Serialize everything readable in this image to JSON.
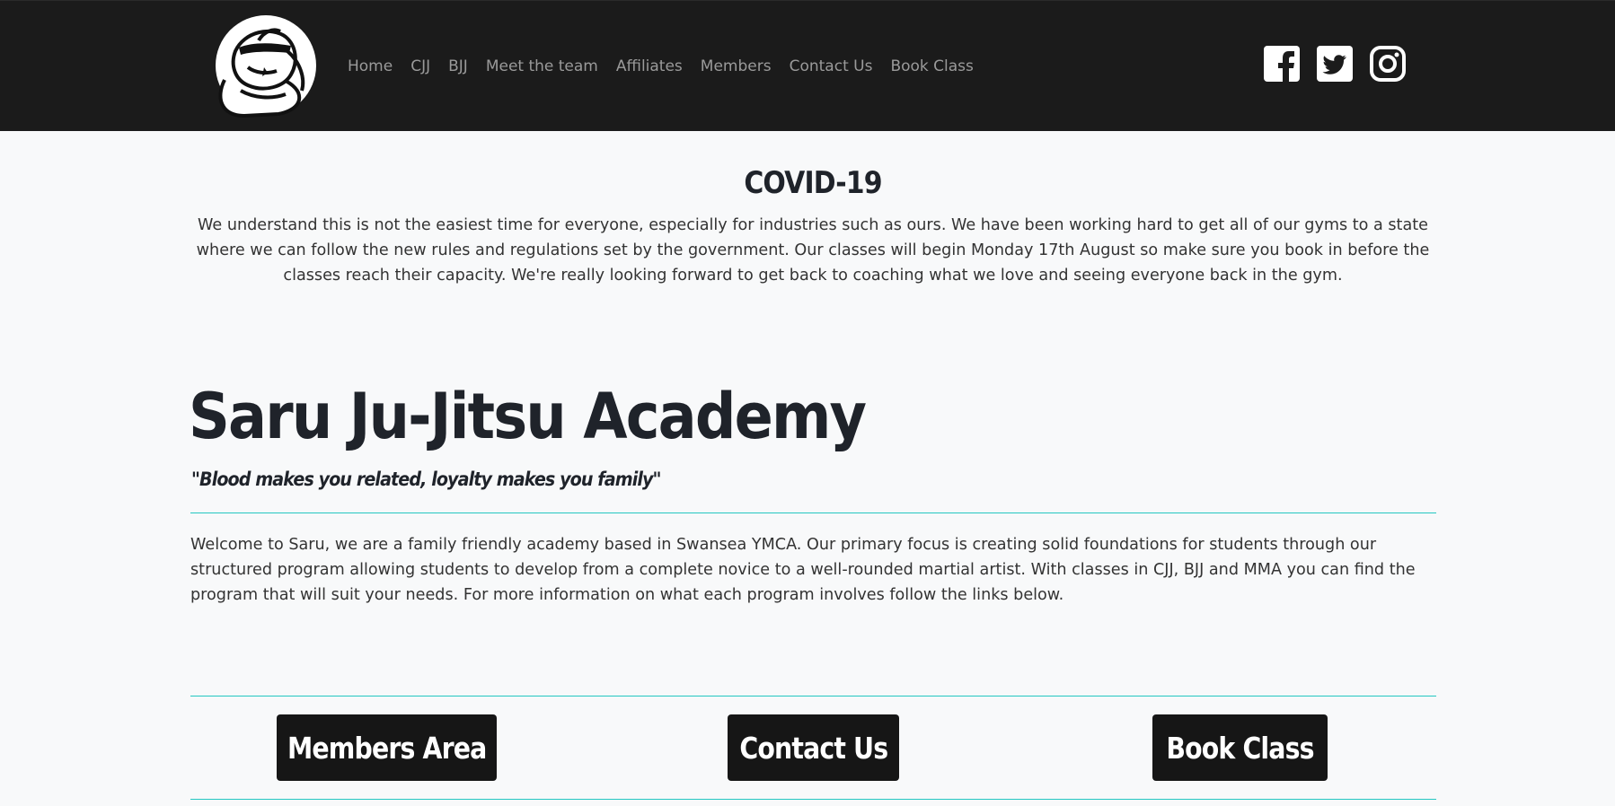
{
  "nav": {
    "logo_name": "saru-logo",
    "links": [
      "Home",
      "CJJ",
      "BJJ",
      "Meet the team",
      "Affiliates",
      "Members",
      "Contact Us",
      "Book Class"
    ],
    "social": [
      "facebook-icon",
      "twitter-icon",
      "instagram-icon"
    ]
  },
  "covid": {
    "title": "COVID-19",
    "text": "We understand this is not the easiest time for everyone, especially for industries such as ours. We have been working hard to get all of our gyms to a state where we can follow the new rules and regulations set by the government. Our classes will begin Monday 17th August so make sure you book in before the classes reach their capacity. We're really looking forward to get back to coaching what we love and seeing everyone back in the gym."
  },
  "hero": {
    "title": "Saru Ju-Jitsu Academy",
    "motto": "\"Blood makes you related, loyalty makes you family\"",
    "intro": "Welcome to Saru, we are a family friendly academy based in Swansea YMCA. Our primary focus is creating solid foundations for students through our structured program allowing students to develop from a complete novice to a well-rounded martial artist. With classes in CJJ, BJJ and MMA you can find the program that will suit your needs. For more information on what each program involves follow the links below."
  },
  "buttons": {
    "members": "Members Area",
    "contact": "Contact Us",
    "book": "Book Class"
  },
  "colors": {
    "navbar": "#1b1b1b",
    "accent_rule": "#24c7c1",
    "button_bg": "#161616",
    "page_bg": "#f8f9fa"
  }
}
